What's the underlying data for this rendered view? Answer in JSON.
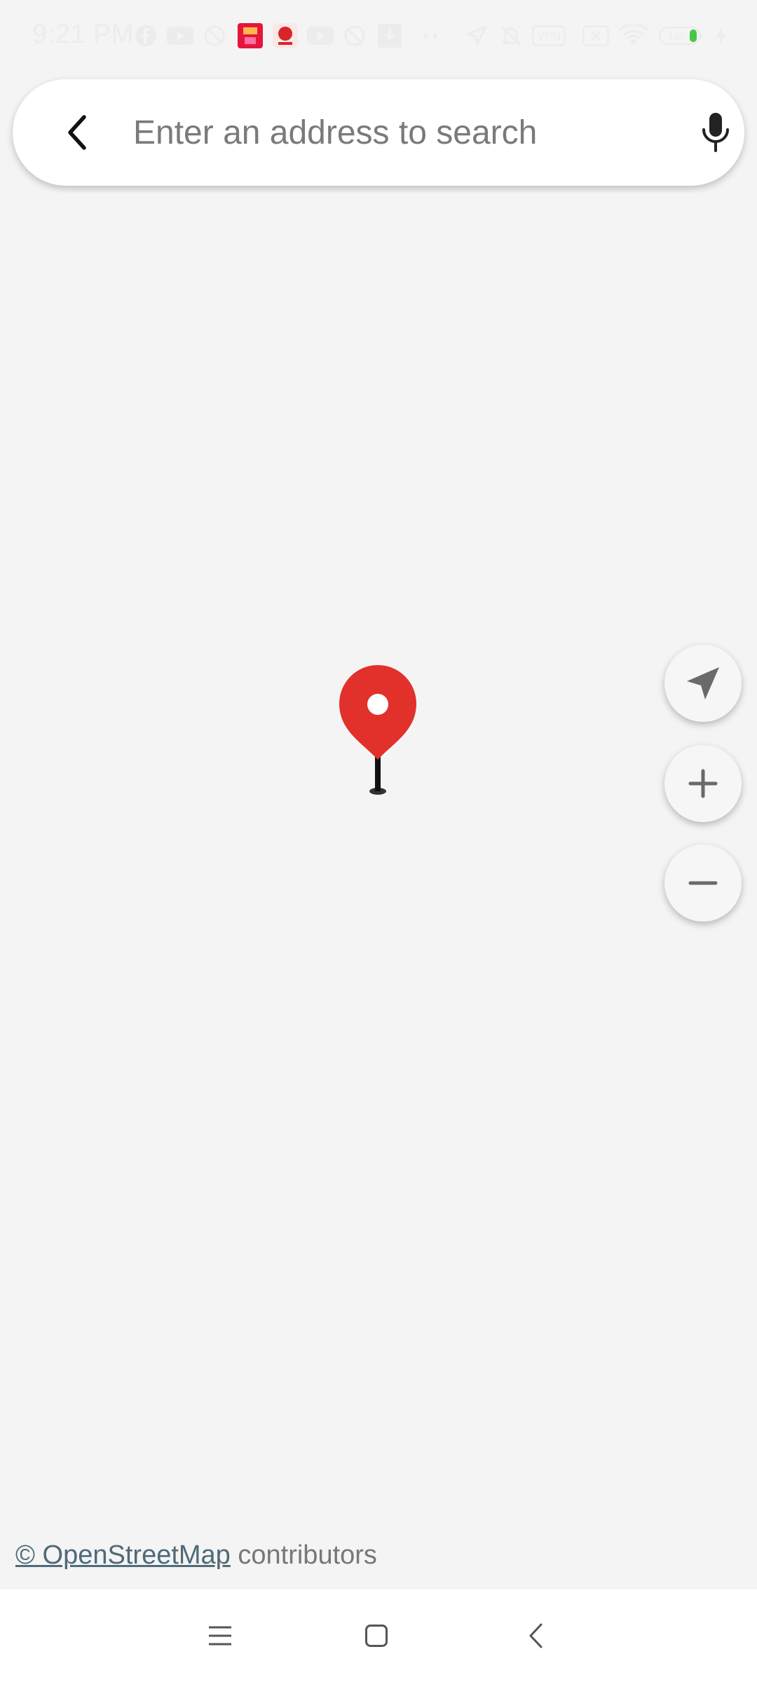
{
  "status_bar": {
    "time": "9:21 PM",
    "battery": "100",
    "vpn_label": "VPN"
  },
  "search": {
    "placeholder": "Enter an address to search",
    "value": ""
  },
  "map": {
    "attribution_link": "© OpenStreetMap",
    "attribution_text": " contributors"
  },
  "colors": {
    "pin": "#e2302b",
    "map_background": "#f4f4f4"
  },
  "icons": {
    "back": "back-arrow-icon",
    "mic": "mic-icon",
    "locate": "navigation-arrow-icon",
    "zoom_in": "plus-icon",
    "zoom_out": "minus-icon",
    "pin": "location-pin-icon",
    "nav_menu": "menu-icon",
    "nav_home": "home-icon",
    "nav_back": "back-icon"
  }
}
